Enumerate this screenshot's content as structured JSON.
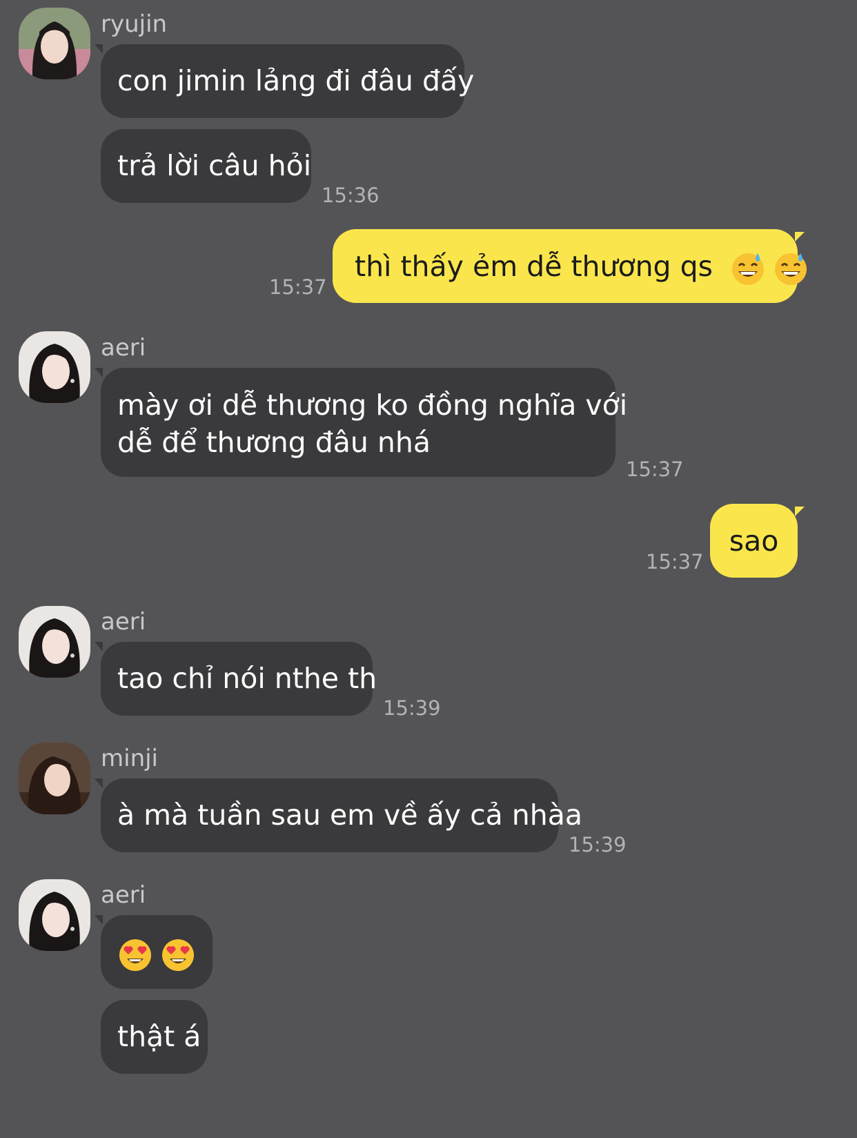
{
  "chat": {
    "messages": [
      {
        "sender": "ryujin",
        "texts": [
          "con jimin lảng đi đâu đấy",
          "trả lời câu hỏi"
        ],
        "time": "15:36"
      },
      {
        "sender": "me",
        "text": "thì thấy ẻm dễ thương qs",
        "emojis": [
          "grinning-sweat-emoji",
          "grinning-sweat-emoji"
        ],
        "time": "15:37"
      },
      {
        "sender": "aeri",
        "line1": "mày ơi dễ thương ko đồng nghĩa với",
        "line2": "dễ để thương đâu nhá",
        "time": "15:37"
      },
      {
        "sender": "me",
        "text": "sao",
        "time": "15:37"
      },
      {
        "sender": "aeri",
        "text": "tao chỉ nói nthe th",
        "time": "15:39"
      },
      {
        "sender": "minji",
        "text": "à mà tuần sau em về ấy cả nhàa",
        "time": "15:39"
      },
      {
        "sender": "aeri",
        "emojis": [
          "heart-eyes-emoji",
          "heart-eyes-emoji"
        ],
        "text2": "thật á"
      }
    ]
  },
  "colors": {
    "background": "#545356",
    "incoming_bubble": "#3a393c",
    "outgoing_bubble": "#fae64c"
  }
}
